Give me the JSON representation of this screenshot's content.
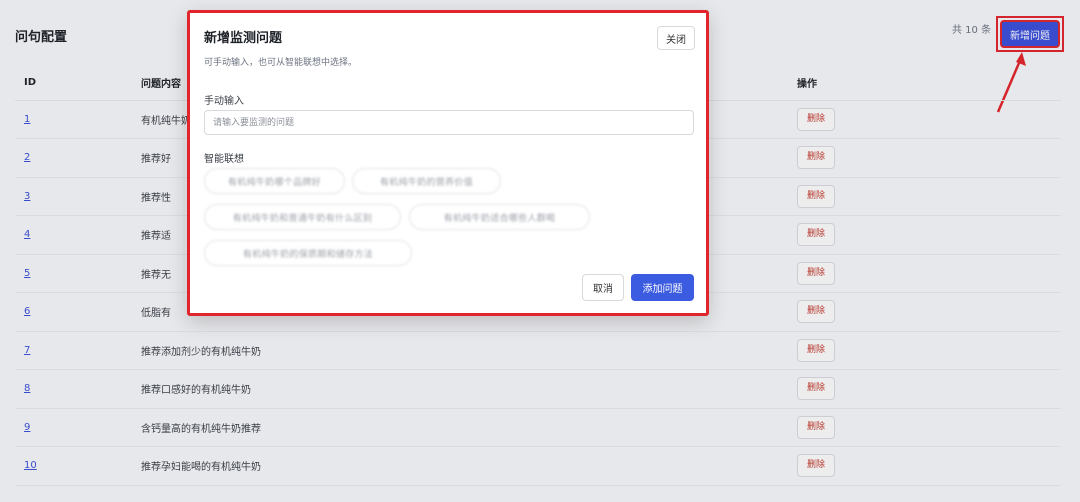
{
  "page": {
    "title": "问句配置",
    "total": "共 10 条",
    "add_button": "新增问题",
    "columns": {
      "id": "ID",
      "question": "问题内容",
      "action": "操作"
    },
    "delete_label": "删除",
    "rows": [
      {
        "id": "1",
        "question": "有机纯牛奶"
      },
      {
        "id": "2",
        "question": "推荐好"
      },
      {
        "id": "3",
        "question": "推荐性"
      },
      {
        "id": "4",
        "question": "推荐适"
      },
      {
        "id": "5",
        "question": "推荐无"
      },
      {
        "id": "6",
        "question": "低脂有"
      },
      {
        "id": "7",
        "question": "推荐添加剂少的有机纯牛奶"
      },
      {
        "id": "8",
        "question": "推荐口感好的有机纯牛奶"
      },
      {
        "id": "9",
        "question": "含钙量高的有机纯牛奶推荐"
      },
      {
        "id": "10",
        "question": "推荐孕妇能喝的有机纯牛奶"
      }
    ]
  },
  "modal": {
    "title": "新增监测问题",
    "close": "关闭",
    "subtitle": "可手动输入，也可从智能联想中选择。",
    "manual_label": "手动输入",
    "manual_placeholder": "请输入要监测的问题",
    "smart_label": "智能联想",
    "chips": [
      "有机纯牛奶哪个品牌好",
      "有机纯牛奶的营养价值",
      "有机纯牛奶和普通牛奶有什么区别",
      "有机纯牛奶适合哪些人群喝",
      "有机纯牛奶的保质期和储存方法"
    ],
    "cancel": "取消",
    "confirm": "添加问题"
  },
  "colors": {
    "accent": "#3b5be0",
    "annotation": "#e0262c",
    "delete_text": "#c0392b"
  }
}
